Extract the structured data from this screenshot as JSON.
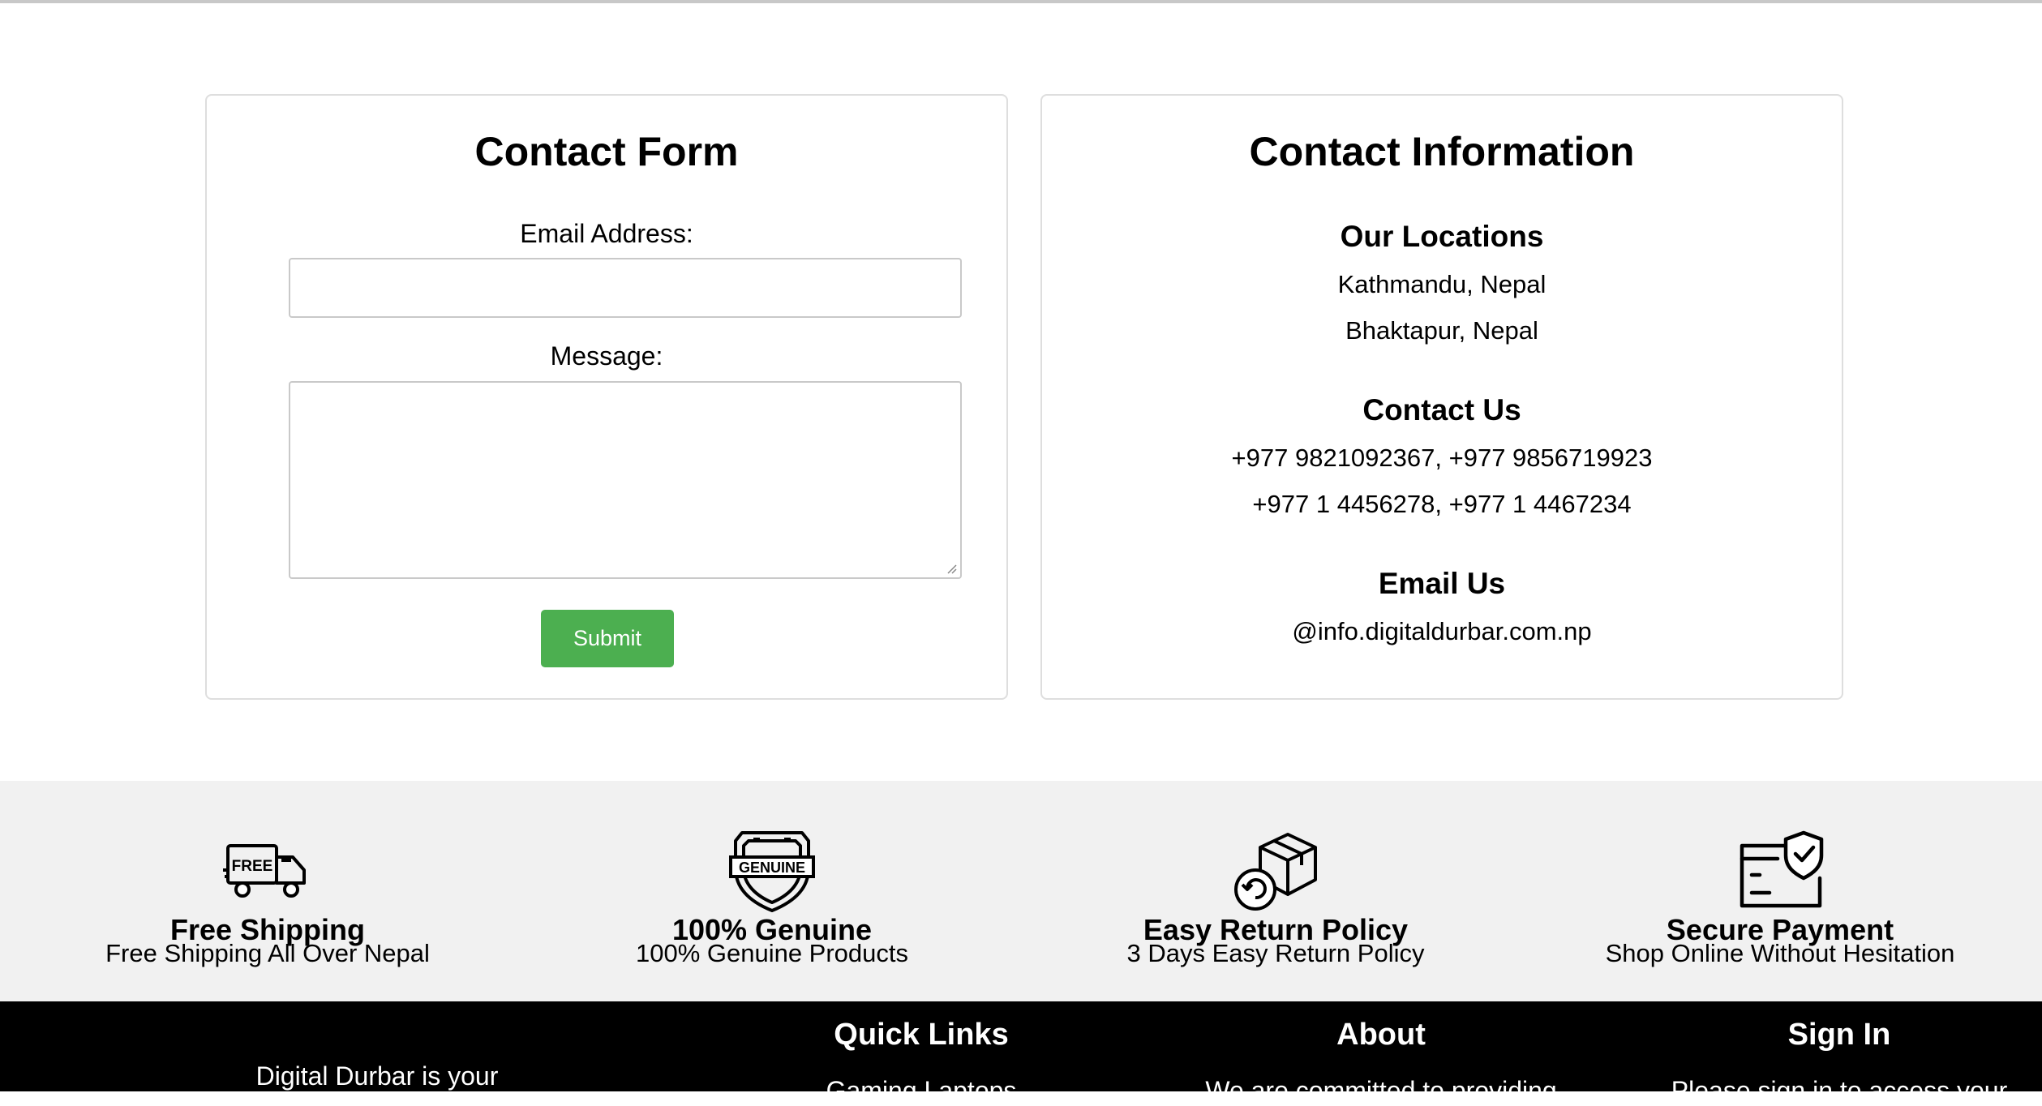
{
  "contact_form": {
    "title": "Contact Form",
    "email_label": "Email Address:",
    "email_value": "",
    "message_label": "Message:",
    "message_value": "",
    "submit_label": "Submit"
  },
  "contact_info": {
    "title": "Contact Information",
    "locations_heading": "Our Locations",
    "locations": [
      "Kathmandu, Nepal",
      "Bhaktapur, Nepal"
    ],
    "contact_heading": "Contact Us",
    "phones": [
      "+977 9821092367, +977 9856719923",
      "+977 1 4456278, +977 1 4467234"
    ],
    "email_heading": "Email Us",
    "email": "@info.digitaldurbar.com.np"
  },
  "features": [
    {
      "icon": "free-shipping-truck-icon",
      "title": "Free Shipping",
      "subtitle": "Free Shipping All Over Nepal"
    },
    {
      "icon": "genuine-badge-icon",
      "title": "100% Genuine",
      "subtitle": "100% Genuine Products"
    },
    {
      "icon": "return-box-icon",
      "title": "Easy Return Policy",
      "subtitle": "3 Days Easy Return Policy"
    },
    {
      "icon": "secure-payment-card-icon",
      "title": "Secure Payment",
      "subtitle": "Shop Online Without Hesitation"
    }
  ],
  "footer": {
    "about_text": "Digital Durbar is your",
    "quick_links_heading": "Quick Links",
    "quick_links_first": "Gaming Laptops",
    "about_heading": "About",
    "about_first_line": "We are committed to providing",
    "sign_in_heading": "Sign In",
    "sign_in_first_line": "Please sign in to access your"
  },
  "colors": {
    "submit_bg": "#4caf50",
    "features_bg": "#f1f1f1",
    "footer_bg": "#000000"
  }
}
